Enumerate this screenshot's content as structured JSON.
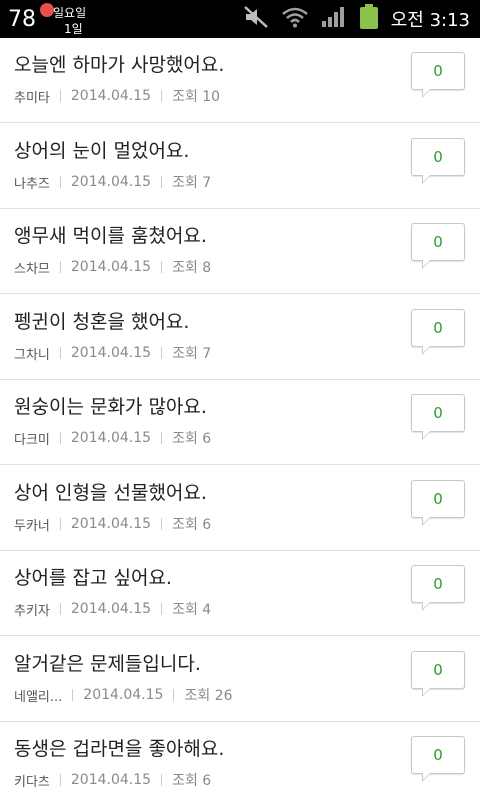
{
  "status_bar": {
    "temperature": "78",
    "calendar_day": "일요일",
    "calendar_date": "1일",
    "time": "오전 3:13",
    "battery_color": "#8bc34a"
  },
  "colors": {
    "comment_count": "#2e9b2e",
    "divider": "#e2e2e2"
  },
  "posts": [
    {
      "title": "오늘엔 하마가 사망했어요.",
      "author": "추미타",
      "date": "2014.04.15",
      "views": "조회 10",
      "comments": "0"
    },
    {
      "title": "상어의 눈이 멀었어요.",
      "author": "나추즈",
      "date": "2014.04.15",
      "views": "조회 7",
      "comments": "0"
    },
    {
      "title": "앵무새 먹이를 훔쳤어요.",
      "author": "스차므",
      "date": "2014.04.15",
      "views": "조회 8",
      "comments": "0"
    },
    {
      "title": "펭귄이 청혼을 했어요.",
      "author": "그차니",
      "date": "2014.04.15",
      "views": "조회 7",
      "comments": "0"
    },
    {
      "title": "원숭이는 문화가 많아요.",
      "author": "다크미",
      "date": "2014.04.15",
      "views": "조회 6",
      "comments": "0"
    },
    {
      "title": "상어 인형을 선물했어요.",
      "author": "두카너",
      "date": "2014.04.15",
      "views": "조회 6",
      "comments": "0"
    },
    {
      "title": "상어를 잡고 싶어요.",
      "author": "추키자",
      "date": "2014.04.15",
      "views": "조회 4",
      "comments": "0"
    },
    {
      "title": "알거같은 문제들입니다.",
      "author": "네앨리...",
      "date": "2014.04.15",
      "views": "조회 26",
      "comments": "0"
    },
    {
      "title": "동생은 겁라면을 좋아해요.",
      "author": "키다츠",
      "date": "2014.04.15",
      "views": "조회 6",
      "comments": "0"
    }
  ]
}
